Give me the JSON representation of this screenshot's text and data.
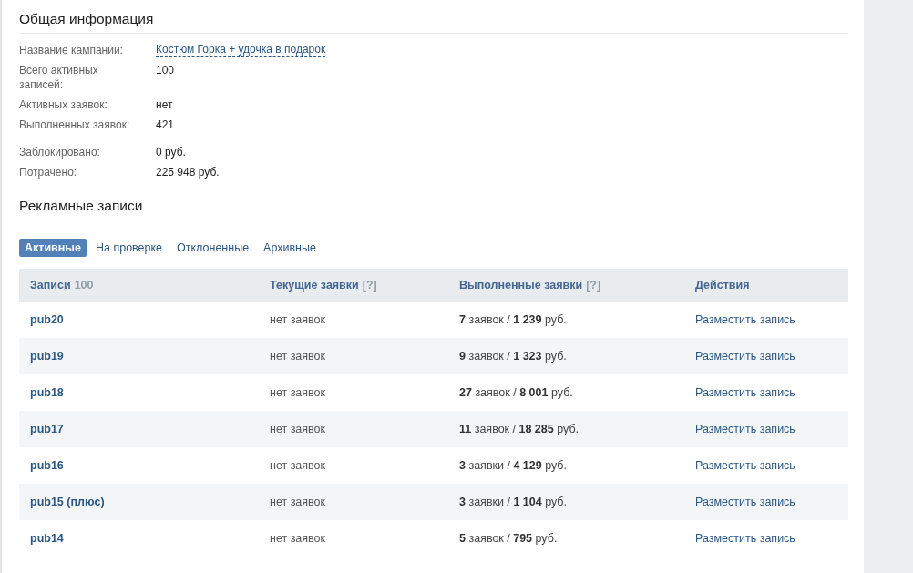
{
  "general": {
    "title": "Общая информация",
    "groups": [
      [
        {
          "label": "Название кампании:",
          "value": "Костюм Горка + удочка в подарок",
          "kind": "link"
        },
        {
          "label": "Всего активных записей:",
          "value": "100",
          "kind": "text"
        },
        {
          "label": "Активных заявок:",
          "value": "нет",
          "kind": "text"
        },
        {
          "label": "Выполненных заявок:",
          "value": "421",
          "kind": "text"
        }
      ],
      [
        {
          "label": "Заблокировано:",
          "value": "0 руб.",
          "kind": "text"
        },
        {
          "label": "Потрачено:",
          "value": "225 948 руб.",
          "kind": "text"
        }
      ]
    ]
  },
  "posts": {
    "title": "Рекламные записи",
    "tabs": [
      {
        "label": "Активные",
        "selected": true
      },
      {
        "label": "На проверке",
        "selected": false
      },
      {
        "label": "Отклоненные",
        "selected": false
      },
      {
        "label": "Архивные",
        "selected": false
      }
    ],
    "table": {
      "columns": [
        {
          "label": "Записи",
          "extra": "100"
        },
        {
          "label": "Текущие заявки",
          "extra": "[?]"
        },
        {
          "label": "Выполненные заявки",
          "extra": "[?]"
        },
        {
          "label": "Действия"
        }
      ],
      "rows": [
        {
          "name": "pub20",
          "current": "нет заявок",
          "completed": "**7** заявок / **1 239** руб.",
          "action": "Разместить запись"
        },
        {
          "name": "pub19",
          "current": "нет заявок",
          "completed": "**9** заявок / **1 323** руб.",
          "action": "Разместить запись"
        },
        {
          "name": "pub18",
          "current": "нет заявок",
          "completed": "**27** заявок / **8 001** руб.",
          "action": "Разместить запись"
        },
        {
          "name": "pub17",
          "current": "нет заявок",
          "completed": "**11** заявок / **18 285** руб.",
          "action": "Разместить запись"
        },
        {
          "name": "pub16",
          "current": "нет заявок",
          "completed": "**3** заявки / **4 129** руб.",
          "action": "Разместить запись"
        },
        {
          "name": "pub15 (плюс)",
          "current": "нет заявок",
          "completed": "**3** заявки / **1 104** руб.",
          "action": "Разместить запись"
        },
        {
          "name": "pub14",
          "current": "нет заявок",
          "completed": "**5** заявок / **795** руб.",
          "action": "Разместить запись"
        }
      ]
    }
  }
}
